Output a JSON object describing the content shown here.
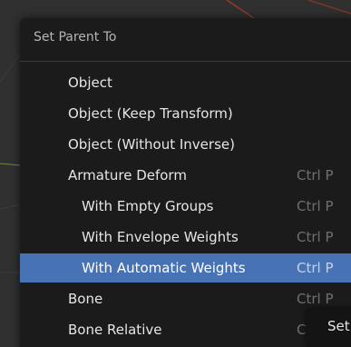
{
  "menu": {
    "title": "Set Parent To",
    "items": [
      {
        "label": "Object",
        "shortcut": ""
      },
      {
        "label": "Object (Keep Transform)",
        "shortcut": ""
      },
      {
        "label": "Object (Without Inverse)",
        "shortcut": ""
      },
      {
        "label": "Armature Deform",
        "shortcut": "Ctrl P"
      },
      {
        "label": "With Empty Groups",
        "shortcut": "Ctrl P"
      },
      {
        "label": "With Envelope Weights",
        "shortcut": "Ctrl P"
      },
      {
        "label": "With Automatic Weights",
        "shortcut": "Ctrl P",
        "state": "highlighted"
      },
      {
        "label": "Bone",
        "shortcut": "Ctrl P"
      },
      {
        "label": "Bone Relative",
        "shortcut": "C"
      }
    ]
  },
  "tooltip": {
    "text": "Set"
  },
  "colors": {
    "menu_background": "#1a1a1a",
    "highlight": "#4772b3",
    "viewport_background": "#303030"
  }
}
